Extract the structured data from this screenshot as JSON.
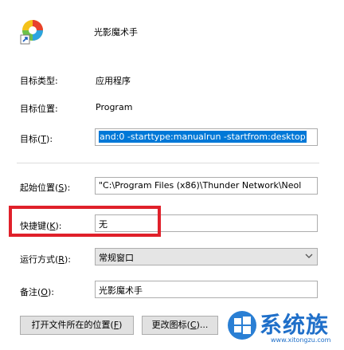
{
  "header": {
    "app_name": "光影魔术手"
  },
  "rows": {
    "target_type": {
      "label": "目标类型:",
      "value": "应用程序"
    },
    "target_location": {
      "label": "目标位置:",
      "value": "Program"
    },
    "target": {
      "label_pre": "目标(",
      "label_key": "T",
      "label_post": "):",
      "value": "and:0 -starttype:manualrun -startfrom:desktop"
    },
    "start_in": {
      "label_pre": "起始位置(",
      "label_key": "S",
      "label_post": "):",
      "value": "\"C:\\Program Files (x86)\\Thunder Network\\Neol"
    },
    "shortcut_key": {
      "label_pre": "快捷键(",
      "label_key": "K",
      "label_post": "):",
      "value": "无"
    },
    "run": {
      "label_pre": "运行方式(",
      "label_key": "R",
      "label_post": "):",
      "value": "常规窗口"
    },
    "comment": {
      "label_pre": "备注(",
      "label_key": "O",
      "label_post": "):",
      "value": "光影魔术手"
    }
  },
  "buttons": {
    "open_location": {
      "pre": "打开文件所在的位置(",
      "key": "F",
      "post": ")"
    },
    "change_icon": {
      "pre": "更改图标(",
      "key": "C",
      "post": ")..."
    }
  },
  "watermark": {
    "brand": "系统族",
    "url": "www.xitongzu.com"
  },
  "colors": {
    "highlight": "#e0202a",
    "selection": "#0078d7"
  }
}
